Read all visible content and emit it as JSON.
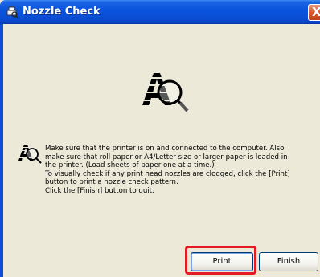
{
  "window": {
    "title": "Nozzle Check",
    "close_glyph": "X",
    "title_icon": "printer-nozzle-icon"
  },
  "main": {
    "large_icon": "nozzle-check-magnifier-icon",
    "small_icon": "nozzle-check-magnifier-icon",
    "message_lines": [
      "Make sure that the printer is on and connected to the computer. Also",
      "make sure that roll paper or A4/Letter size or larger paper is loaded in",
      "the printer. (Load sheets of paper one at a time.)",
      "To visually check if any print head nozzles are clogged, click the [Print]",
      "button to print a nozzle check pattern.",
      "Click the [Finish] button to quit."
    ]
  },
  "buttons": {
    "print_label": "Print",
    "finish_label": "Finish"
  },
  "colors": {
    "titlebar": "#0a54dd",
    "highlight": "#e31b23",
    "dialog_bg": "#ece9d8"
  }
}
